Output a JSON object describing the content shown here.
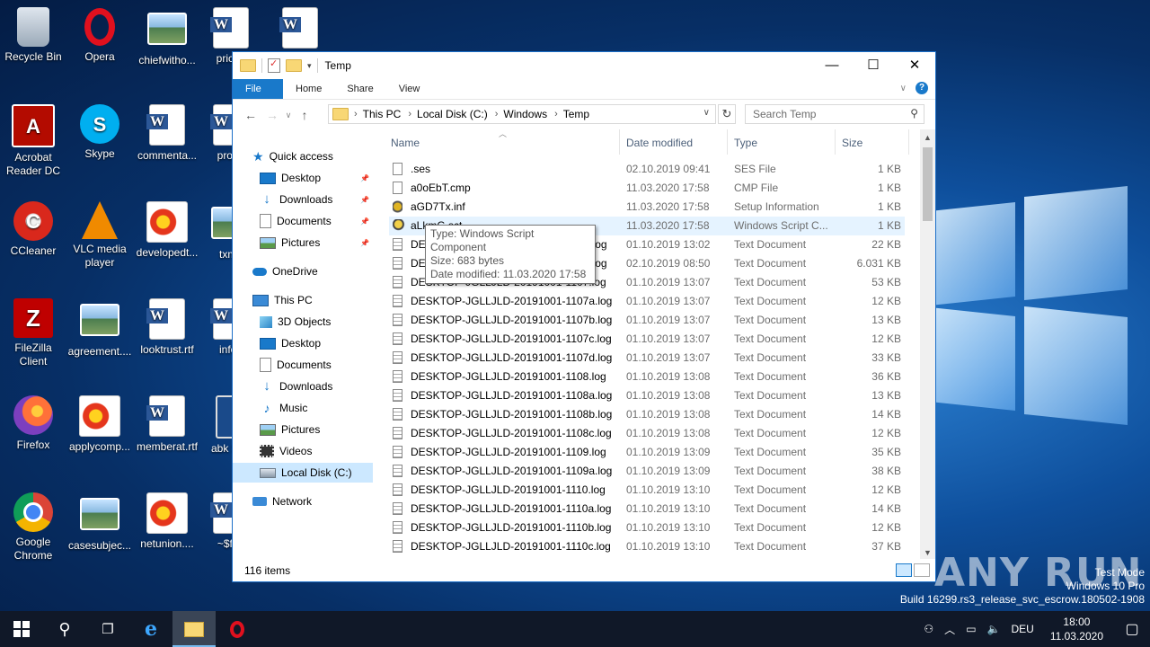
{
  "desktop": {
    "icons": [
      {
        "label": "Recycle Bin",
        "icon": "recycle-bin-icon"
      },
      {
        "label": "Opera",
        "icon": "opera-icon"
      },
      {
        "label": "chiefwitho...",
        "icon": "image-file-icon"
      },
      {
        "label": "priceh",
        "icon": "word-doc-icon"
      },
      {
        "label": "",
        "icon": "word-doc-icon"
      },
      {
        "label": "Acrobat Reader DC",
        "icon": "acrobat-icon"
      },
      {
        "label": "Skype",
        "icon": "skype-icon"
      },
      {
        "label": "commenta...",
        "icon": "word-doc-icon"
      },
      {
        "label": "produ",
        "icon": "word-doc-icon"
      },
      {
        "label": "CCleaner",
        "icon": "ccleaner-icon"
      },
      {
        "label": "VLC media player",
        "icon": "vlc-icon"
      },
      {
        "label": "developedt...",
        "icon": "flower-image-icon"
      },
      {
        "label": "txma",
        "icon": "image-file-icon"
      },
      {
        "label": "FileZilla Client",
        "icon": "filezilla-icon"
      },
      {
        "label": "agreement....",
        "icon": "image-file-icon"
      },
      {
        "label": "looktrust.rtf",
        "icon": "word-doc-icon"
      },
      {
        "label": "info_",
        "icon": "word-doc-icon"
      },
      {
        "label": "Firefox",
        "icon": "firefox-icon"
      },
      {
        "label": "applycomp...",
        "icon": "flower-image-icon"
      },
      {
        "label": "memberat.rtf",
        "icon": "word-doc-icon"
      },
      {
        "label": "abk Sho",
        "icon": "monitor-icon"
      },
      {
        "label": "Google Chrome",
        "icon": "chrome-icon"
      },
      {
        "label": "casesubjec...",
        "icon": "image-file-icon"
      },
      {
        "label": "netunion....",
        "icon": "flower-image-icon"
      },
      {
        "label": "~$fo_",
        "icon": "word-doc-icon"
      }
    ]
  },
  "window": {
    "title": "Temp",
    "ribbon_tabs": [
      "File",
      "Home",
      "Share",
      "View"
    ],
    "address": {
      "crumbs": [
        "This PC",
        "Local Disk (C:)",
        "Windows",
        "Temp"
      ]
    },
    "search": {
      "placeholder": "Search Temp"
    },
    "sidebar": [
      {
        "label": "Quick access",
        "icon": "star-icon",
        "pinned": false,
        "indent": 0,
        "selected": false
      },
      {
        "label": "Desktop",
        "icon": "desktop-icon",
        "pinned": true,
        "indent": 1,
        "selected": false
      },
      {
        "label": "Downloads",
        "icon": "downloads-icon",
        "pinned": true,
        "indent": 1,
        "selected": false
      },
      {
        "label": "Documents",
        "icon": "documents-icon",
        "pinned": true,
        "indent": 1,
        "selected": false
      },
      {
        "label": "Pictures",
        "icon": "pictures-icon",
        "pinned": true,
        "indent": 1,
        "selected": false
      },
      {
        "label": "OneDrive",
        "icon": "onedrive-icon",
        "pinned": false,
        "indent": 0,
        "selected": false
      },
      {
        "label": "This PC",
        "icon": "this-pc-icon",
        "pinned": false,
        "indent": 0,
        "selected": false
      },
      {
        "label": "3D Objects",
        "icon": "3d-objects-icon",
        "pinned": false,
        "indent": 1,
        "selected": false
      },
      {
        "label": "Desktop",
        "icon": "desktop-icon",
        "pinned": false,
        "indent": 1,
        "selected": false
      },
      {
        "label": "Documents",
        "icon": "documents-icon",
        "pinned": false,
        "indent": 1,
        "selected": false
      },
      {
        "label": "Downloads",
        "icon": "downloads-icon",
        "pinned": false,
        "indent": 1,
        "selected": false
      },
      {
        "label": "Music",
        "icon": "music-icon",
        "pinned": false,
        "indent": 1,
        "selected": false
      },
      {
        "label": "Pictures",
        "icon": "pictures-icon",
        "pinned": false,
        "indent": 1,
        "selected": false
      },
      {
        "label": "Videos",
        "icon": "videos-icon",
        "pinned": false,
        "indent": 1,
        "selected": false
      },
      {
        "label": "Local Disk (C:)",
        "icon": "drive-icon",
        "pinned": false,
        "indent": 1,
        "selected": true
      },
      {
        "label": "Network",
        "icon": "network-icon",
        "pinned": false,
        "indent": 0,
        "selected": false
      }
    ],
    "columns": [
      "Name",
      "Date modified",
      "Type",
      "Size"
    ],
    "files": [
      {
        "name": ".ses",
        "date": "02.10.2019 09:41",
        "type": "SES File",
        "size": "1 KB",
        "icon": "blank-file-icon"
      },
      {
        "name": "a0oEbT.cmp",
        "date": "11.03.2020 17:58",
        "type": "CMP File",
        "size": "1 KB",
        "icon": "blank-file-icon"
      },
      {
        "name": "aGD7Tx.inf",
        "date": "11.03.2020 17:58",
        "type": "Setup Information",
        "size": "1 KB",
        "icon": "setup-file-icon"
      },
      {
        "name": "aLkmG.sct",
        "date": "11.03.2020 17:58",
        "type": "Windows Script C...",
        "size": "1 KB",
        "icon": "script-component-icon"
      },
      {
        "name": "DESKTOP-JGLLJLD-20191001-1302.log",
        "date": "01.10.2019 13:02",
        "type": "Text Document",
        "size": "22 KB",
        "icon": "text-file-icon"
      },
      {
        "name": "DESKTOP-JGLLJLD-20191002-0850.log",
        "date": "02.10.2019 08:50",
        "type": "Text Document",
        "size": "6.031 KB",
        "icon": "text-file-icon"
      },
      {
        "name": "DESKTOP-JGLLJLD-20191001-1107.log",
        "date": "01.10.2019 13:07",
        "type": "Text Document",
        "size": "53 KB",
        "icon": "text-file-icon"
      },
      {
        "name": "DESKTOP-JGLLJLD-20191001-1107a.log",
        "date": "01.10.2019 13:07",
        "type": "Text Document",
        "size": "12 KB",
        "icon": "text-file-icon"
      },
      {
        "name": "DESKTOP-JGLLJLD-20191001-1107b.log",
        "date": "01.10.2019 13:07",
        "type": "Text Document",
        "size": "13 KB",
        "icon": "text-file-icon"
      },
      {
        "name": "DESKTOP-JGLLJLD-20191001-1107c.log",
        "date": "01.10.2019 13:07",
        "type": "Text Document",
        "size": "12 KB",
        "icon": "text-file-icon"
      },
      {
        "name": "DESKTOP-JGLLJLD-20191001-1107d.log",
        "date": "01.10.2019 13:07",
        "type": "Text Document",
        "size": "33 KB",
        "icon": "text-file-icon"
      },
      {
        "name": "DESKTOP-JGLLJLD-20191001-1108.log",
        "date": "01.10.2019 13:08",
        "type": "Text Document",
        "size": "36 KB",
        "icon": "text-file-icon"
      },
      {
        "name": "DESKTOP-JGLLJLD-20191001-1108a.log",
        "date": "01.10.2019 13:08",
        "type": "Text Document",
        "size": "13 KB",
        "icon": "text-file-icon"
      },
      {
        "name": "DESKTOP-JGLLJLD-20191001-1108b.log",
        "date": "01.10.2019 13:08",
        "type": "Text Document",
        "size": "14 KB",
        "icon": "text-file-icon"
      },
      {
        "name": "DESKTOP-JGLLJLD-20191001-1108c.log",
        "date": "01.10.2019 13:08",
        "type": "Text Document",
        "size": "12 KB",
        "icon": "text-file-icon"
      },
      {
        "name": "DESKTOP-JGLLJLD-20191001-1109.log",
        "date": "01.10.2019 13:09",
        "type": "Text Document",
        "size": "35 KB",
        "icon": "text-file-icon"
      },
      {
        "name": "DESKTOP-JGLLJLD-20191001-1109a.log",
        "date": "01.10.2019 13:09",
        "type": "Text Document",
        "size": "38 KB",
        "icon": "text-file-icon"
      },
      {
        "name": "DESKTOP-JGLLJLD-20191001-1110.log",
        "date": "01.10.2019 13:10",
        "type": "Text Document",
        "size": "12 KB",
        "icon": "text-file-icon"
      },
      {
        "name": "DESKTOP-JGLLJLD-20191001-1110a.log",
        "date": "01.10.2019 13:10",
        "type": "Text Document",
        "size": "14 KB",
        "icon": "text-file-icon"
      },
      {
        "name": "DESKTOP-JGLLJLD-20191001-1110b.log",
        "date": "01.10.2019 13:10",
        "type": "Text Document",
        "size": "12 KB",
        "icon": "text-file-icon"
      },
      {
        "name": "DESKTOP-JGLLJLD-20191001-1110c.log",
        "date": "01.10.2019 13:10",
        "type": "Text Document",
        "size": "37 KB",
        "icon": "text-file-icon"
      }
    ],
    "tooltip": {
      "type_line": "Type: Windows Script Component",
      "size_line": "Size: 683 bytes",
      "date_line": "Date modified: 11.03.2020 17:58"
    },
    "status": {
      "item_count": "116 items"
    }
  },
  "watermark": {
    "brand": "ANY RUN",
    "mode": "Test Mode",
    "edition": "Windows 10 Pro",
    "build": "Build 16299.rs3_release_svc_escrow.180502-1908"
  },
  "taskbar": {
    "language": "DEU",
    "time": "18:00",
    "date": "11.03.2020"
  },
  "colors": {
    "accent": "#1979ca",
    "selection": "#cce8ff",
    "hover": "#e5f3ff",
    "taskbar": "#101828"
  }
}
